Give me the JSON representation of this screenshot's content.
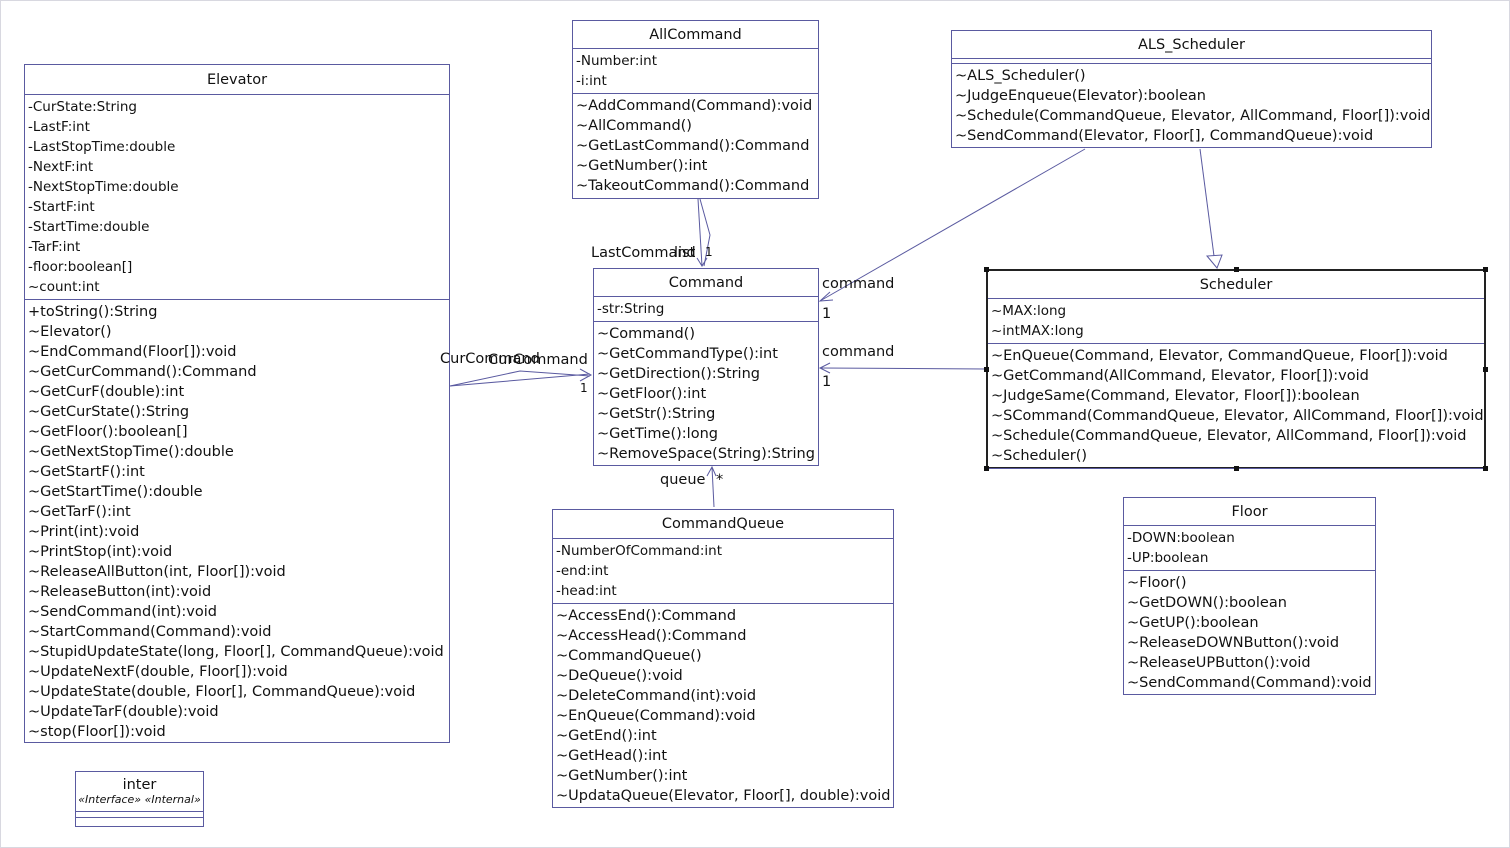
{
  "classes": [
    {
      "id": "elevator",
      "name": "Elevator",
      "attributes": [
        "-CurState:String",
        "-LastF:int",
        "-LastStopTime:double",
        "-NextF:int",
        "-NextStopTime:double",
        "-StartF:int",
        "-StartTime:double",
        "-TarF:int",
        "-floor:boolean[]",
        "~count:int"
      ],
      "methods": [
        "+toString():String",
        "~Elevator()",
        "~EndCommand(Floor[]):void",
        "~GetCurCommand():Command",
        "~GetCurF(double):int",
        "~GetCurState():String",
        "~GetFloor():boolean[]",
        "~GetNextStopTime():double",
        "~GetStartF():int",
        "~GetStartTime():double",
        "~GetTarF():int",
        "~Print(int):void",
        "~PrintStop(int):void",
        "~ReleaseAllButton(int, Floor[]):void",
        "~ReleaseButton(int):void",
        "~SendCommand(int):void",
        "~StartCommand(Command):void",
        "~StupidUpdateState(long, Floor[], CommandQueue):void",
        "~UpdateNextF(double, Floor[]):void",
        "~UpdateState(double, Floor[], CommandQueue):void",
        "~UpdateTarF(double):void",
        "~stop(Floor[]):void"
      ]
    },
    {
      "id": "allcommand",
      "name": "AllCommand",
      "attributes": [
        "-Number:int",
        "-i:int"
      ],
      "methods": [
        "~AddCommand(Command):void",
        "~AllCommand()",
        "~GetLastCommand():Command",
        "~GetNumber():int",
        "~TakeoutCommand():Command"
      ]
    },
    {
      "id": "als",
      "name": "ALS_Scheduler",
      "attributes": [],
      "methods": [
        "~ALS_Scheduler()",
        "~JudgeEnqueue(Elevator):boolean",
        "~Schedule(CommandQueue, Elevator, AllCommand, Floor[]):void",
        "~SendCommand(Elevator, Floor[], CommandQueue):void"
      ]
    },
    {
      "id": "command",
      "name": "Command",
      "attributes": [
        "-str:String"
      ],
      "methods": [
        "~Command()",
        "~GetCommandType():int",
        "~GetDirection():String",
        "~GetFloor():int",
        "~GetStr():String",
        "~GetTime():long",
        "~RemoveSpace(String):String"
      ]
    },
    {
      "id": "scheduler",
      "name": "Scheduler",
      "selected": true,
      "attributes": [
        "~MAX:long",
        "~intMAX:long"
      ],
      "methods": [
        "~EnQueue(Command, Elevator, CommandQueue, Floor[]):void",
        "~GetCommand(AllCommand, Elevator, Floor[]):void",
        "~JudgeSame(Command, Elevator, Floor[]):boolean",
        "~SCommand(CommandQueue, Elevator, AllCommand, Floor[]):void",
        "~Schedule(CommandQueue, Elevator, AllCommand, Floor[]):void",
        "~Scheduler()"
      ]
    },
    {
      "id": "commandqueue",
      "name": "CommandQueue",
      "attributes": [
        "-NumberOfCommand:int",
        "-end:int",
        "-head:int"
      ],
      "methods": [
        "~AccessEnd():Command",
        "~AccessHead():Command",
        "~CommandQueue()",
        "~DeQueue():void",
        "~DeleteCommand(int):void",
        "~EnQueue(Command):void",
        "~GetEnd():int",
        "~GetHead():int",
        "~GetNumber():int",
        "~UpdataQueue(Elevator, Floor[], double):void"
      ]
    },
    {
      "id": "floor",
      "name": "Floor",
      "attributes": [
        "-DOWN:boolean",
        "-UP:boolean"
      ],
      "methods": [
        "~Floor()",
        "~GetDOWN():boolean",
        "~GetUP():boolean",
        "~ReleaseDOWNButton():void",
        "~ReleaseUPButton():void",
        "~SendCommand(Command):void"
      ]
    },
    {
      "id": "inter",
      "name": "inter",
      "stereotype": "«Interface» «Internal»",
      "attributes": [],
      "methods": []
    }
  ],
  "association_labels": {
    "last_command": "LastCommand",
    "list": "list",
    "list_mult": "1",
    "last_mult": "1",
    "cur_command_1": "CurCommand",
    "cur_command_2": "CurCommand",
    "cur_mult": "1",
    "command_1": "command",
    "command_1_mult": "1",
    "command_2": "command",
    "command_2_mult": "1",
    "queue": "queue",
    "queue_mult": "*"
  },
  "colors": {
    "line": "#5a5aa0",
    "text": "#111111"
  }
}
